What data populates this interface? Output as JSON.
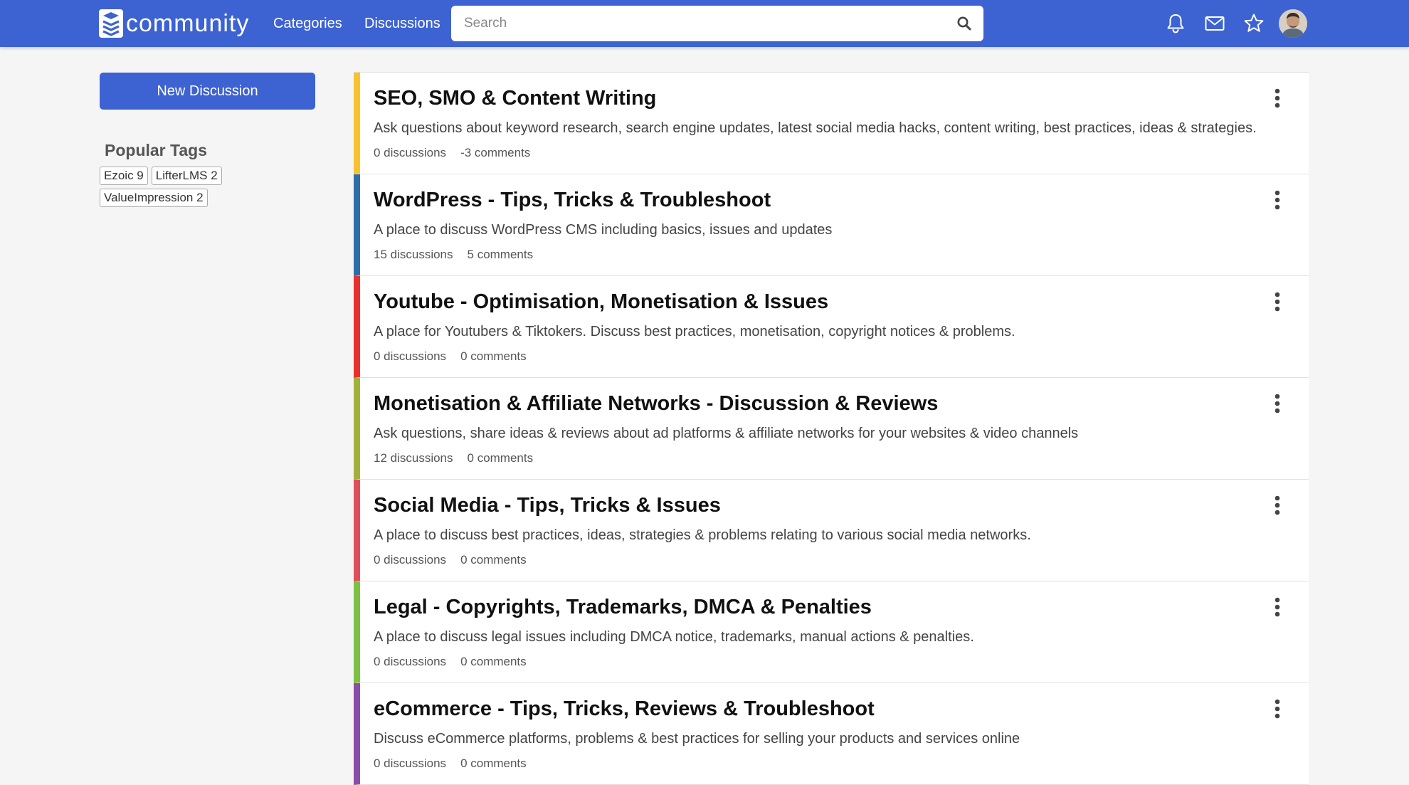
{
  "header": {
    "logo_text": "community",
    "nav": {
      "categories": "Categories",
      "discussions": "Discussions"
    },
    "search": {
      "placeholder": "Search"
    },
    "icons": [
      "bell-icon",
      "mail-icon",
      "star-icon",
      "user-avatar"
    ],
    "accent_color": "#3d63d2"
  },
  "sidebar": {
    "new_discussion_label": "New Discussion",
    "popular_tags_title": "Popular Tags",
    "tags": [
      {
        "label": "Ezoic 9"
      },
      {
        "label": "LifterLMS 2"
      },
      {
        "label": "ValueImpression 2"
      }
    ]
  },
  "categories": [
    {
      "title": "SEO, SMO & Content Writing",
      "description": "Ask questions about keyword research, search engine updates, latest social media hacks, content writing, best practices, ideas & strategies.",
      "discussions": "0 discussions",
      "comments": "-3 comments",
      "color": "#f7c230"
    },
    {
      "title": "WordPress - Tips, Tricks & Troubleshoot",
      "description": "A place to discuss WordPress CMS including basics, issues and updates",
      "discussions": "15 discussions",
      "comments": "5 comments",
      "color": "#2f6da8"
    },
    {
      "title": "Youtube - Optimisation, Monetisation & Issues",
      "description": "A place for Youtubers & Tiktokers. Discuss best practices, monetisation, copyright notices & problems.",
      "discussions": "0 discussions",
      "comments": "0 comments",
      "color": "#e8312c"
    },
    {
      "title": "Monetisation & Affiliate Networks - Discussion & Reviews",
      "description": "Ask questions, share ideas & reviews about ad platforms & affiliate networks for your websites & video channels",
      "discussions": "12 discussions",
      "comments": "0 comments",
      "color": "#a3b13c"
    },
    {
      "title": "Social Media - Tips, Tricks & Issues",
      "description": "A place to discuss best practices, ideas, strategies & problems relating to various social media networks.",
      "discussions": "0 discussions",
      "comments": "0 comments",
      "color": "#e04e5d"
    },
    {
      "title": "Legal - Copyrights, Trademarks, DMCA & Penalties",
      "description": "A place to discuss legal issues including DMCA notice, trademarks, manual actions & penalties.",
      "discussions": "0 discussions",
      "comments": "0 comments",
      "color": "#7dc142"
    },
    {
      "title": "eCommerce - Tips, Tricks, Reviews & Troubleshoot",
      "description": "Discuss eCommerce platforms, problems & best practices for selling your products and services online",
      "discussions": "0 discussions",
      "comments": "0 comments",
      "color": "#8b4ea6"
    }
  ]
}
